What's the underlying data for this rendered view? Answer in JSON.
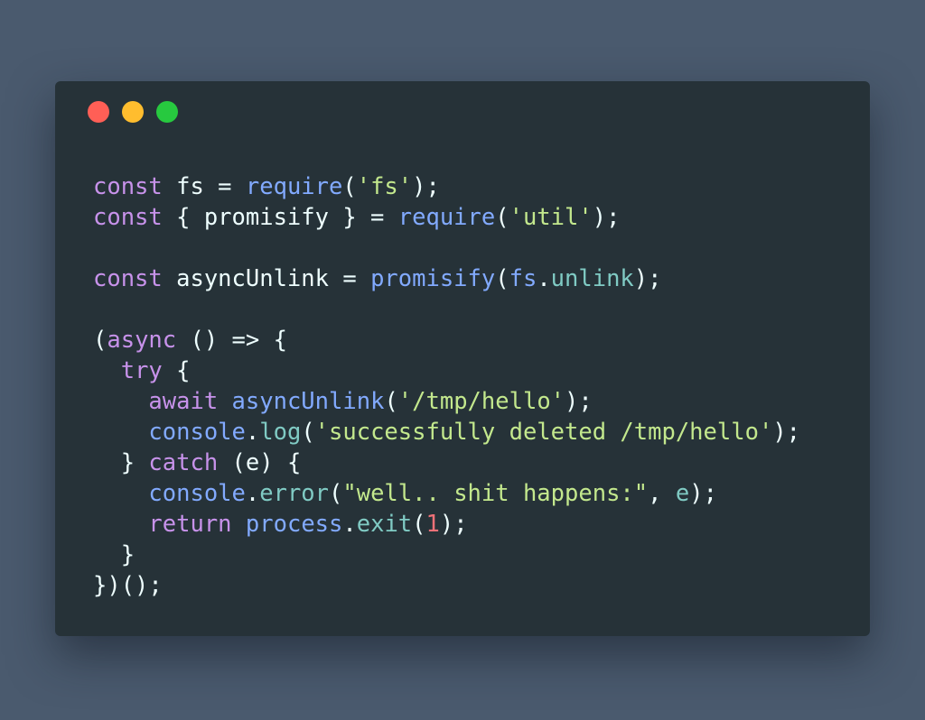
{
  "window": {
    "controls": [
      {
        "name": "close",
        "color": "#ff5f56"
      },
      {
        "name": "minimize",
        "color": "#ffbd2e"
      },
      {
        "name": "maximize",
        "color": "#27c93f"
      }
    ]
  },
  "theme": {
    "background": "#4a5a6e",
    "editor_background": "#263238",
    "keyword": "#c792ea",
    "function": "#82aaff",
    "string": "#c3e88d",
    "property": "#80cbc4",
    "number": "#f07178",
    "default": "#eeffff"
  },
  "code": {
    "lines": [
      [
        [
          "keyword",
          "const"
        ],
        [
          "default",
          " fs = "
        ],
        [
          "function",
          "require"
        ],
        [
          "default",
          "("
        ],
        [
          "string",
          "'fs'"
        ],
        [
          "default",
          ");"
        ]
      ],
      [
        [
          "keyword",
          "const"
        ],
        [
          "default",
          " { promisify } = "
        ],
        [
          "function",
          "require"
        ],
        [
          "default",
          "("
        ],
        [
          "string",
          "'util'"
        ],
        [
          "default",
          ");"
        ]
      ],
      [],
      [
        [
          "keyword",
          "const"
        ],
        [
          "default",
          " asyncUnlink = "
        ],
        [
          "function",
          "promisify"
        ],
        [
          "default",
          "("
        ],
        [
          "function",
          "fs"
        ],
        [
          "default",
          "."
        ],
        [
          "property",
          "unlink"
        ],
        [
          "default",
          ");"
        ]
      ],
      [],
      [
        [
          "default",
          "("
        ],
        [
          "keyword",
          "async"
        ],
        [
          "default",
          " () => {"
        ]
      ],
      [
        [
          "default",
          "  "
        ],
        [
          "keyword",
          "try"
        ],
        [
          "default",
          " {"
        ]
      ],
      [
        [
          "default",
          "    "
        ],
        [
          "keyword",
          "await"
        ],
        [
          "default",
          " "
        ],
        [
          "function",
          "asyncUnlink"
        ],
        [
          "default",
          "("
        ],
        [
          "string",
          "'/tmp/hello'"
        ],
        [
          "default",
          ");"
        ]
      ],
      [
        [
          "default",
          "    "
        ],
        [
          "function",
          "console"
        ],
        [
          "default",
          "."
        ],
        [
          "property",
          "log"
        ],
        [
          "default",
          "("
        ],
        [
          "string",
          "'successfully deleted /tmp/hello'"
        ],
        [
          "default",
          ");"
        ]
      ],
      [
        [
          "default",
          "  } "
        ],
        [
          "keyword",
          "catch"
        ],
        [
          "default",
          " (e) {"
        ]
      ],
      [
        [
          "default",
          "    "
        ],
        [
          "function",
          "console"
        ],
        [
          "default",
          "."
        ],
        [
          "property",
          "error"
        ],
        [
          "default",
          "("
        ],
        [
          "string",
          "\"well.. shit happens:\""
        ],
        [
          "default",
          ", "
        ],
        [
          "property",
          "e"
        ],
        [
          "default",
          ");"
        ]
      ],
      [
        [
          "default",
          "    "
        ],
        [
          "keyword",
          "return"
        ],
        [
          "default",
          " "
        ],
        [
          "function",
          "process"
        ],
        [
          "default",
          "."
        ],
        [
          "property",
          "exit"
        ],
        [
          "default",
          "("
        ],
        [
          "number",
          "1"
        ],
        [
          "default",
          ");"
        ]
      ],
      [
        [
          "default",
          "  }"
        ]
      ],
      [
        [
          "default",
          "})();"
        ]
      ]
    ]
  }
}
